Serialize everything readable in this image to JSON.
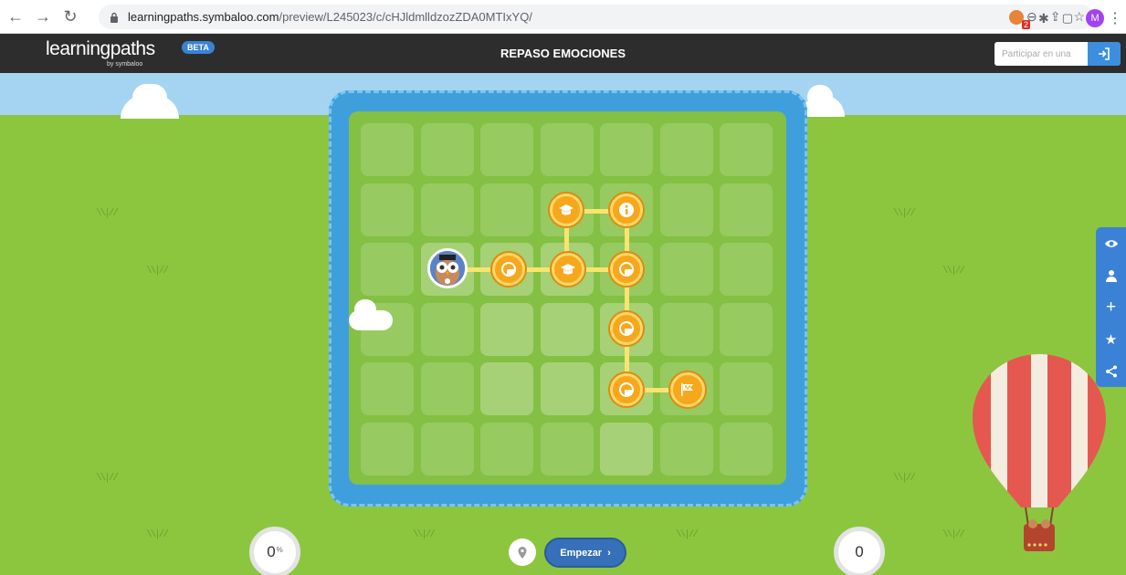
{
  "browser": {
    "url_host": "learningpaths.symbaloo.com",
    "url_path": "/preview/L245023/c/cHJldmlldzozZDA0MTIxYQ/",
    "profile_initial": "M",
    "extension_badge": "2",
    "icons": [
      "back-icon",
      "forward-icon",
      "reload-icon",
      "lock-icon",
      "zoom-icon",
      "share-icon",
      "bookmark-star-icon",
      "extensions-puzzle-icon",
      "side-panel-icon",
      "menu-kebab-icon"
    ]
  },
  "header": {
    "logo": "learningpaths",
    "logo_sub": "by symbaloo",
    "badge": "BETA",
    "title": "REPASO EMOCIONES",
    "join_placeholder": "Participar en una",
    "join_icon": "enter-icon"
  },
  "board": {
    "grid_cols": 7,
    "grid_rows": 6,
    "nodes": [
      {
        "type": "avatar",
        "icon": "owl-avatar-icon"
      },
      {
        "type": "content",
        "icon": "web-link-icon"
      },
      {
        "type": "content",
        "icon": "graduation-cap-icon"
      },
      {
        "type": "content",
        "icon": "graduation-cap-icon"
      },
      {
        "type": "content",
        "icon": "info-icon"
      },
      {
        "type": "content",
        "icon": "web-link-icon"
      },
      {
        "type": "content",
        "icon": "web-link-icon"
      },
      {
        "type": "content",
        "icon": "web-link-icon"
      },
      {
        "type": "finish",
        "icon": "finish-flag-icon"
      }
    ]
  },
  "sidebar": {
    "items": [
      "eye-icon",
      "user-icon",
      "plus-icon",
      "star-icon",
      "share-icon"
    ]
  },
  "footer": {
    "progress_value": "0",
    "progress_unit": "%",
    "score_value": "0",
    "start_label": "Empezar",
    "start_arrow": "›"
  },
  "colors": {
    "appbar": "#2d2d2d",
    "accent": "#3b82d6",
    "node": "#f7a71c",
    "grass": "#8cc63f",
    "water": "#3f9fdd"
  }
}
